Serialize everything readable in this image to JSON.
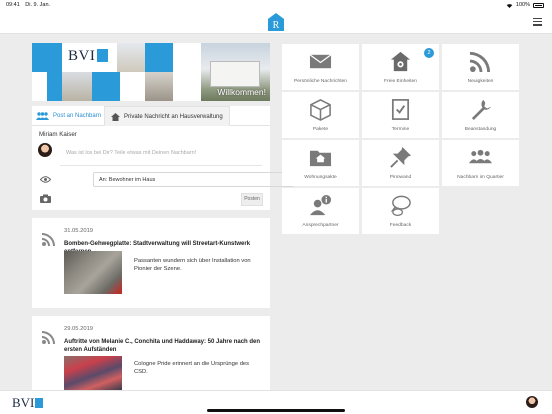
{
  "status": {
    "time": "09:41",
    "date": "Di. 9. Jan.",
    "battery": "100%"
  },
  "banner": {
    "logo_text": "BVI",
    "welcome": "Willkommen!"
  },
  "post": {
    "tab_neighbors": "Post an Nachbarn",
    "tab_private": "Private Nachricht an Hausverwaltung",
    "author": "Miriam Kaiser",
    "placeholder": "Was ist los bei Dir? Teile etwas mit Deinen Nachbarn!",
    "audience": "An: Bewohner im Haus",
    "post_button": "Posten"
  },
  "news": [
    {
      "date": "31.05.2019",
      "title": "Bomben-Gehwegplatte: Stadtverwaltung will Streetart-Kunstwerk entfernen",
      "excerpt": "Passanten wundern sich über Installation von Pionier der Szene."
    },
    {
      "date": "29.05.2019",
      "title": "Auftritte von Melanie C., Conchita und Haddaway: 50 Jahre nach den ersten Aufständen",
      "excerpt": "Cologne Pride erinnert an die Ursprünge des CSD."
    }
  ],
  "tiles": [
    {
      "label": "Persönliche Nachrichten",
      "icon": "envelope-icon"
    },
    {
      "label": "Freie Einheiten",
      "icon": "house-gear-icon",
      "badge": "2"
    },
    {
      "label": "Neuigkeiten",
      "icon": "rss-icon"
    },
    {
      "label": "Pakete",
      "icon": "package-icon"
    },
    {
      "label": "Termine",
      "icon": "checklist-icon"
    },
    {
      "label": "Beanstandung",
      "icon": "wrench-icon"
    },
    {
      "label": "Wohnungsakte",
      "icon": "folder-icon"
    },
    {
      "label": "Pinnwand",
      "icon": "pushpin-icon"
    },
    {
      "label": "Nachbarn im Quartier",
      "icon": "people-icon"
    },
    {
      "label": "Ansprechpartner",
      "icon": "contact-info-icon"
    },
    {
      "label": "Feedback",
      "icon": "speech-bubbles-icon"
    }
  ],
  "footer": {
    "logo_text": "BVI"
  },
  "colors": {
    "accent": "#2a9ad8",
    "icon_gray": "#777777",
    "background": "#ececec"
  }
}
